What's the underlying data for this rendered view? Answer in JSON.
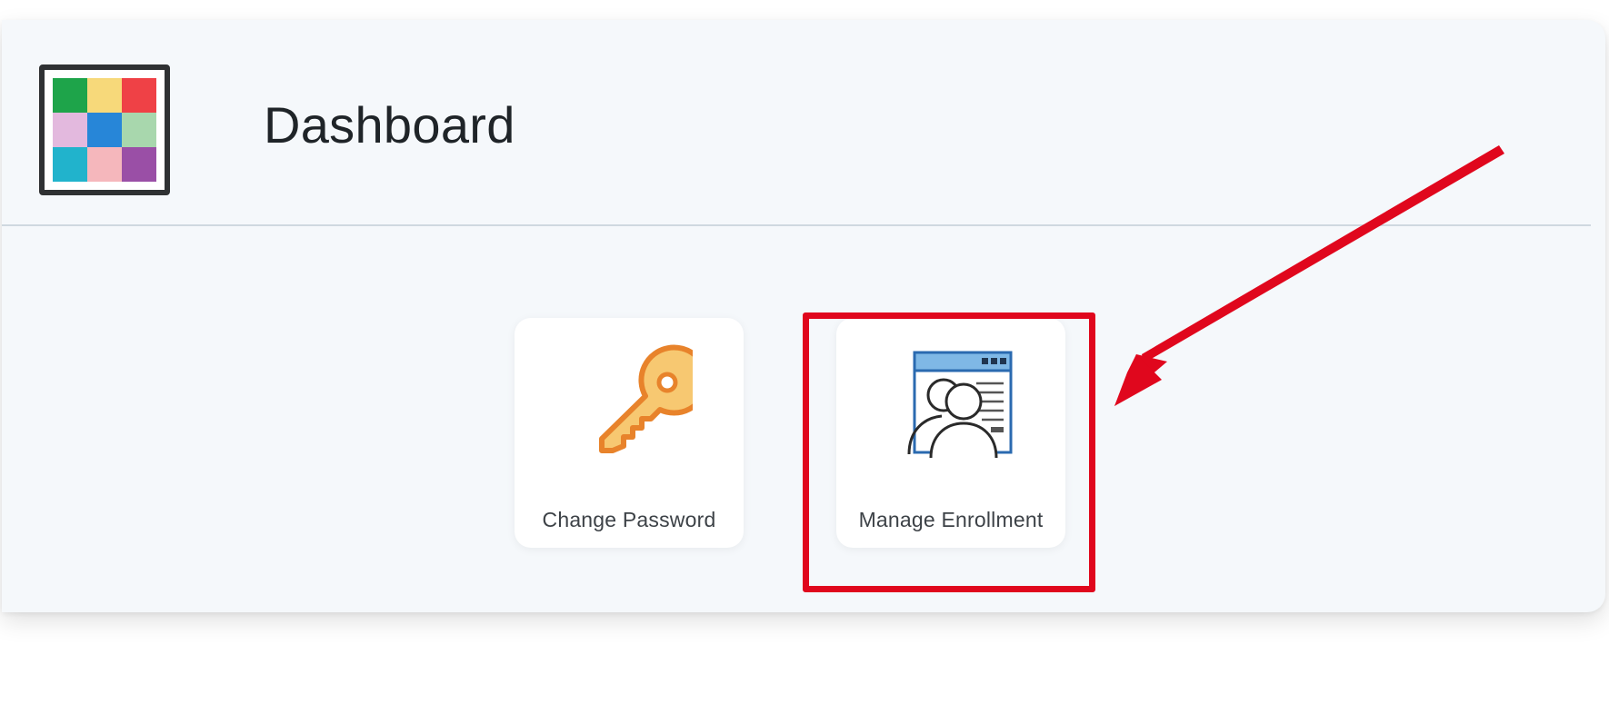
{
  "header": {
    "title": "Dashboard",
    "logo_colors": [
      "#1ea44a",
      "#f7d97a",
      "#ef4146",
      "#e3b9de",
      "#2786d8",
      "#a8d7ad",
      "#21b3cc",
      "#f5b7bc",
      "#9a4fa6"
    ]
  },
  "tiles": [
    {
      "label": "Change Password",
      "icon": "key-icon"
    },
    {
      "label": "Manage Enrollment",
      "icon": "enrollment-users-icon"
    }
  ],
  "annotation": {
    "highlight_color": "#e0071d",
    "arrow_color": "#e0071d"
  },
  "colors": {
    "key_fill": "#f7c871",
    "key_stroke": "#e8832b",
    "window_bar": "#7fb8e6",
    "window_border": "#2a6ab0",
    "line_dark": "#2a2a2a"
  }
}
